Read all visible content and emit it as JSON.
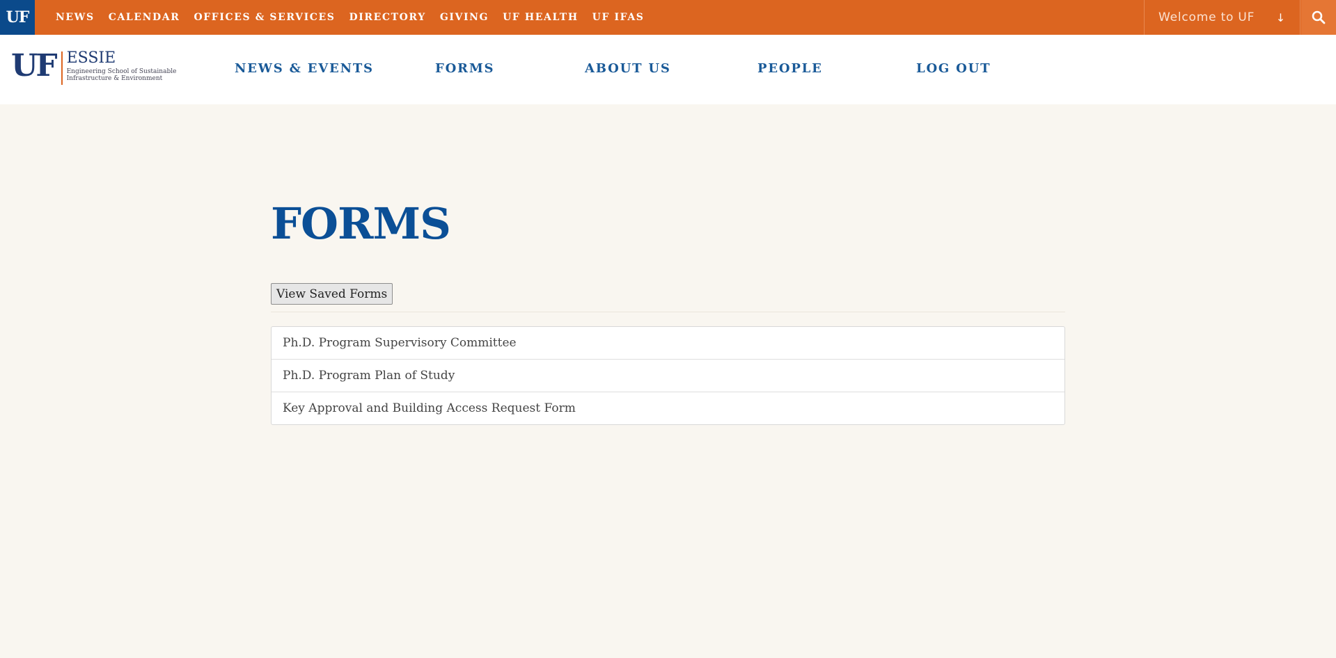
{
  "utility_bar": {
    "badge": "UF",
    "links": [
      "NEWS",
      "CALENDAR",
      "OFFICES & SERVICES",
      "DIRECTORY",
      "GIVING",
      "UF HEALTH",
      "UF IFAS"
    ],
    "welcome": "Welcome to UF",
    "welcome_arrow": "↓",
    "search_icon": "search-icon"
  },
  "header": {
    "logo": {
      "mark": "UF",
      "name": "ESSIE",
      "sub_line1": "Engineering School of Sustainable",
      "sub_line2": "Infrastructure & Environment"
    },
    "nav": [
      "NEWS & EVENTS",
      "FORMS",
      "ABOUT US",
      "PEOPLE",
      "LOG OUT"
    ]
  },
  "main": {
    "title": "FORMS",
    "saved_button": "View Saved Forms",
    "forms": [
      "Ph.D. Program Supervisory Committee",
      "Ph.D. Program Plan of Study",
      "Key Approval and Building Access Request Form"
    ]
  },
  "colors": {
    "accent_orange": "#dc6520",
    "uf_blue": "#0b4a8b",
    "title_blue": "#0b4f96",
    "background": "#f9f6f0"
  }
}
